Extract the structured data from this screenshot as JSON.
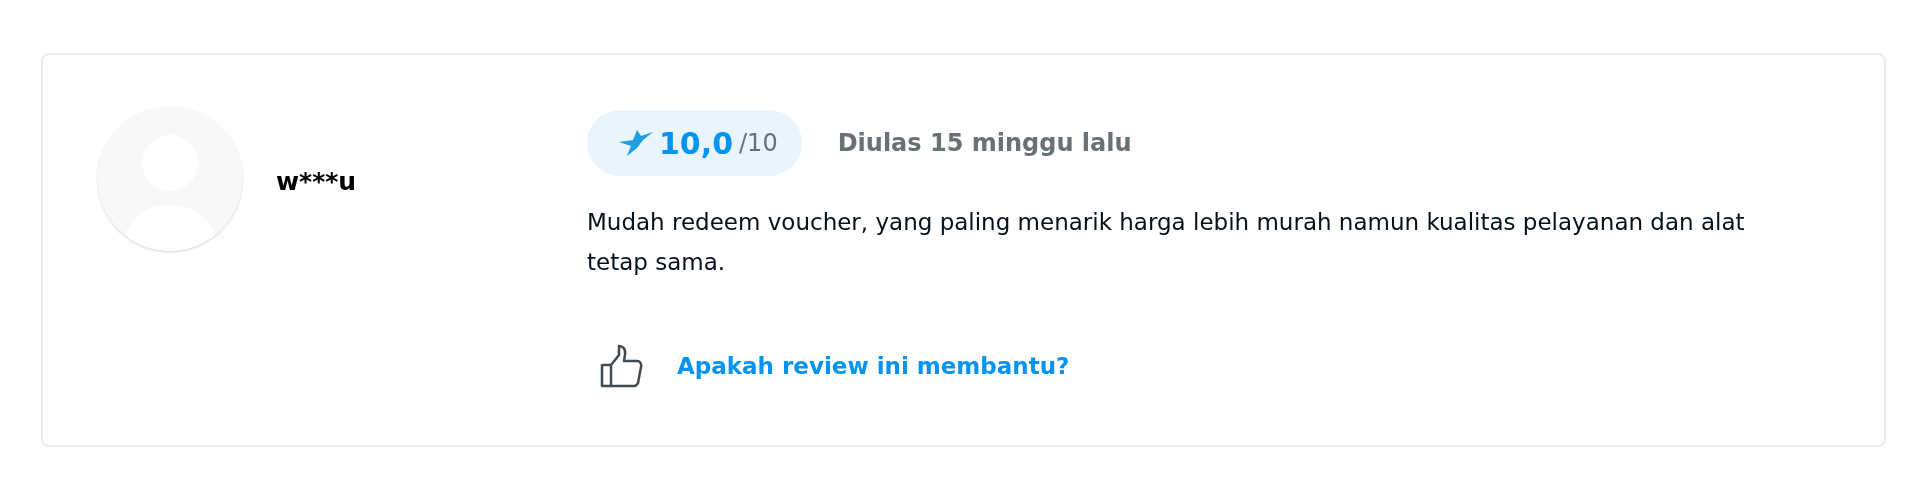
{
  "review": {
    "reviewer": "w***u",
    "score": "10,0",
    "score_max": "/10",
    "date": "Diulas 15 minggu lalu",
    "text": "Mudah redeem voucher, yang paling menarik harga lebih murah namun kualitas pelayanan dan alat tetap sama.",
    "helpful_link": "Apakah review ini membantu?"
  }
}
